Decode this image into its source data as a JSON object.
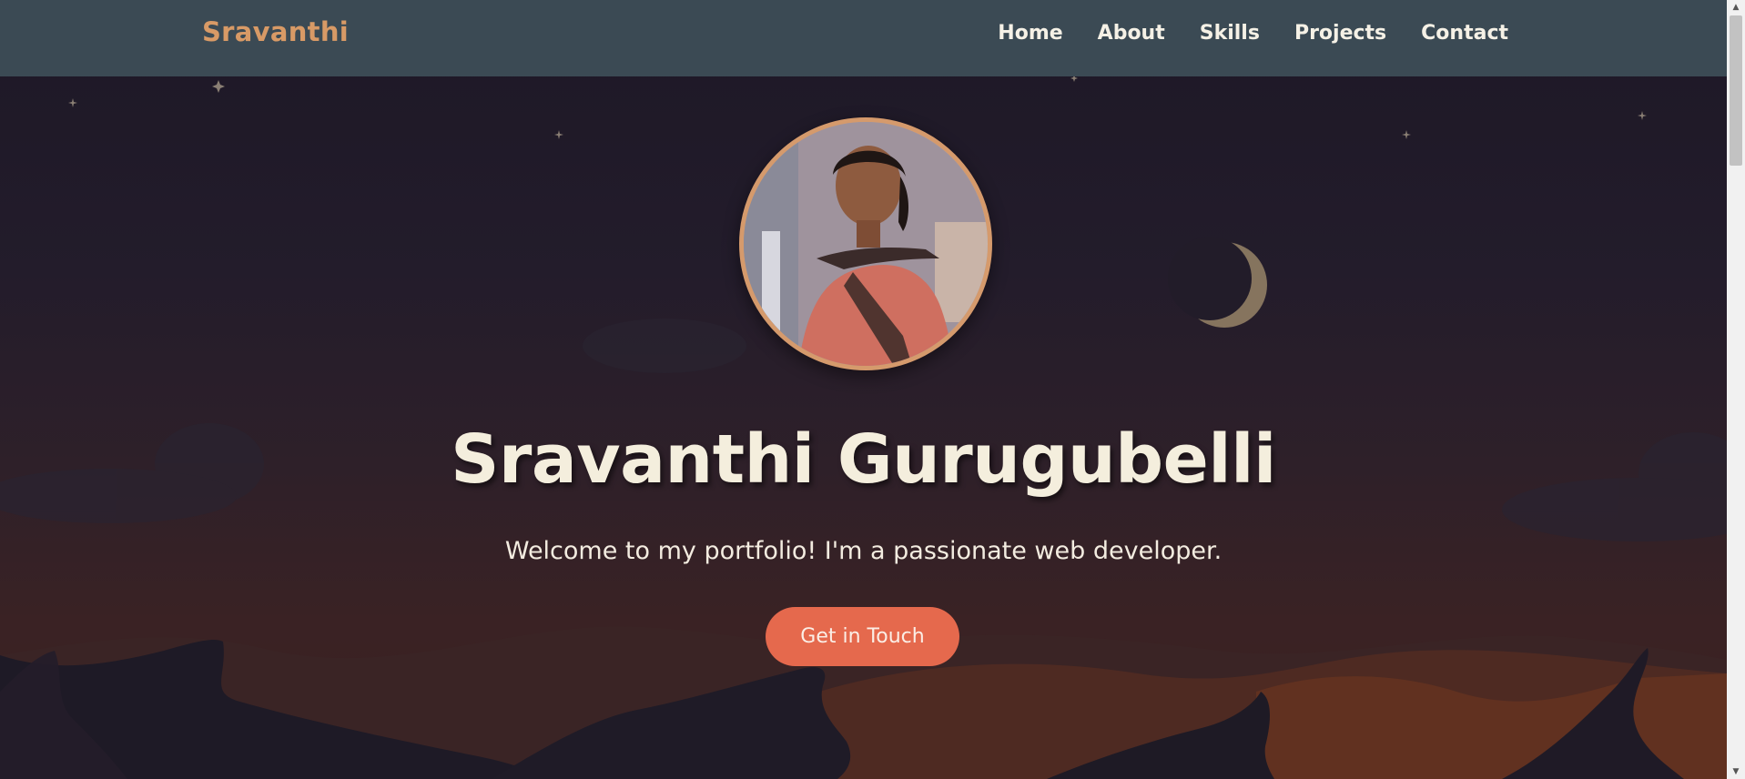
{
  "navbar": {
    "logo": "Sravanthi",
    "links": [
      {
        "label": "Home"
      },
      {
        "label": "About"
      },
      {
        "label": "Skills"
      },
      {
        "label": "Projects"
      },
      {
        "label": "Contact"
      }
    ]
  },
  "hero": {
    "name": "Sravanthi Gurugubelli",
    "tagline": "Welcome to my portfolio! I'm a passionate web developer.",
    "cta_label": "Get in Touch"
  },
  "colors": {
    "nav_bg": "#3b4a54",
    "logo": "#d89a66",
    "cta": "#e5694d",
    "avatar_border": "#d59a6c",
    "heading": "#f4eedd"
  },
  "icons": [
    "star-icon",
    "crescent-moon-icon"
  ]
}
